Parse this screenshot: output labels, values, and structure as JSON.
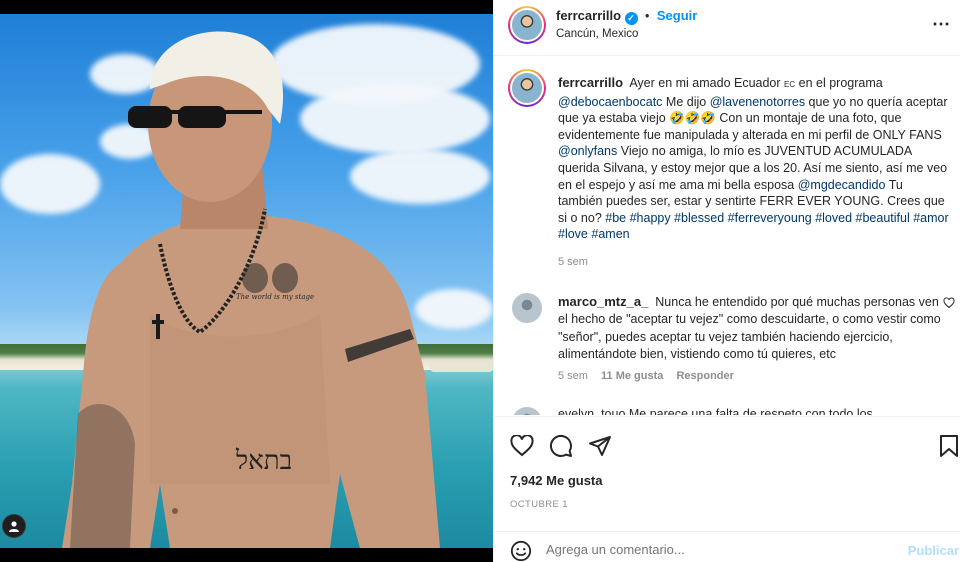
{
  "post": {
    "username": "ferrcarrillo",
    "verified_mark": "✓",
    "separator": "•",
    "follow_label": "Seguir",
    "location": "Cancún, Mexico",
    "more_label": "⋯",
    "photo_text": {
      "neck_tattoo": "The world is my stage",
      "chest_tattoo": "בתאל"
    }
  },
  "caption": {
    "username": "ferrcarrillo",
    "parts": {
      "p1": "Ayer en mi amado Ecuador ",
      "flag": "EC",
      "p2": " en el programa ",
      "m1": "@debocaenbocatc",
      "p3": " Me dijo ",
      "m2": "@lavenenotorres",
      "p4": " que yo no quería aceptar que ya estaba viejo ",
      "emojis": "🤣🤣🤣",
      "p5": " Con un montaje de una foto, que evidentemente fue manipulada y alterada en mi perfil de ONLY FANS ",
      "m3": "@onlyfans",
      "p6": " Viejo no amiga, lo mío es JUVENTUD ACUMULADA querida Silvana, y estoy mejor que a los 20. Así me siento, así me veo en el espejo y así me ama mi bella esposa ",
      "m4": "@mgdecandido",
      "p7": " Tu también puedes ser, estar y sentirte FERR EVER YOUNG. Crees que si o no? ",
      "h1": "#be",
      "h2": "#happy",
      "h3": "#blessed",
      "h4": "#ferreveryoung",
      "h5": "#loved",
      "h6": "#beautiful",
      "h7": "#amor",
      "h8": "#love",
      "h9": "#amen"
    },
    "time": "5 sem"
  },
  "comments": [
    {
      "username": "marco_mtz_a_",
      "text": "Nunca he entendido por qué muchas personas ven el hecho de \"aceptar tu vejez\" como descuidarte, o como vestir como \"señor\", puedes aceptar tu vejez también haciendo ejercicio, alimentándote bien, vistiendo como tú quieres, etc",
      "time": "5 sem",
      "likes": "11 Me gusta",
      "reply_label": "Responder"
    },
    {
      "partial_text": "evelyn_touo  Me parece una falta de respeto con todo los"
    }
  ],
  "actions": {
    "likes": "7,942 Me gusta",
    "date": "OCTUBRE 1"
  },
  "composer": {
    "placeholder": "Agrega un comentario...",
    "publish_label": "Publicar"
  },
  "colors": {
    "accent": "#0095f6",
    "link": "#00376b",
    "muted": "#8e8e8e"
  }
}
